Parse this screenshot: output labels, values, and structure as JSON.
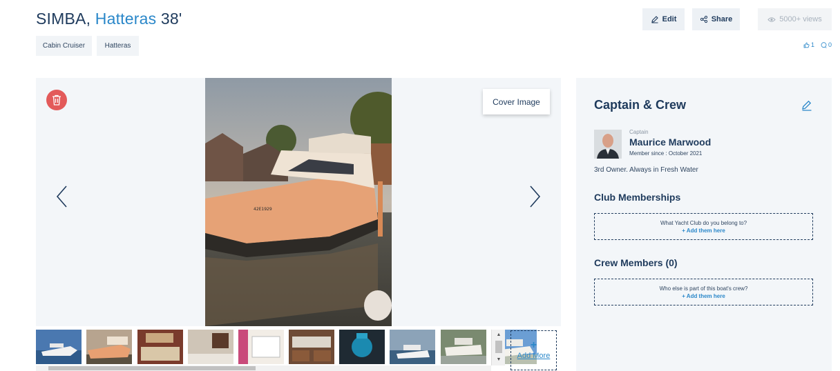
{
  "header": {
    "boat_name": "SIMBA,",
    "boat_model": "Hatteras",
    "boat_length": "38'",
    "tags": [
      "Cabin Cruiser",
      "Hatteras"
    ],
    "edit_label": "Edit",
    "share_label": "Share",
    "views_label": "5000+ views",
    "likes_count": "1",
    "comments_count": "0"
  },
  "gallery": {
    "cover_label": "Cover Image",
    "add_more_plus": "+",
    "add_more_label": "Add More",
    "thumbnail_count": 10
  },
  "panel": {
    "title": "Captain & Crew",
    "captain": {
      "role": "Captain",
      "name": "Maurice Marwood",
      "member_since": "Member since : October 2021",
      "bio": "3rd Owner. Always in Fresh Water"
    },
    "club": {
      "title": "Club Memberships",
      "question": "What Yacht Club do you belong to?",
      "action": "+ Add them here"
    },
    "crew": {
      "title": "Crew Members (0)",
      "question": "Who else is part of this boat's crew?",
      "action": "+ Add them here"
    }
  },
  "colors": {
    "navy": "#1e3a5c",
    "accent": "#2a87c9",
    "delete": "#e35a5a",
    "panel_bg": "#f3f6f9"
  }
}
